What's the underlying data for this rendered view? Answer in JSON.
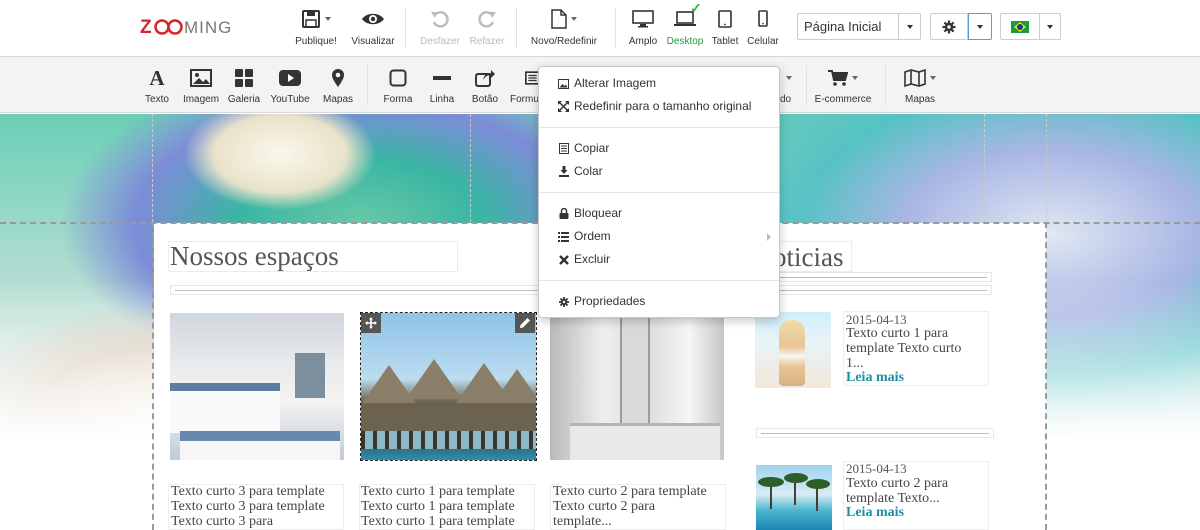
{
  "brand": {
    "logo_text": "ZOOMING"
  },
  "toolbar": {
    "publish": "Publique!",
    "preview": "Visualizar",
    "undo": "Desfazer",
    "redo": "Refazer",
    "new_reset": "Novo/Redefinir",
    "devices": [
      "Amplo",
      "Desktop",
      "Tablet",
      "Celular"
    ],
    "active_device": "Desktop",
    "page_select": "Página Inicial"
  },
  "insert_bar": {
    "items": [
      "Texto",
      "Imagem",
      "Galeria",
      "YouTube",
      "Mapas",
      "Forma",
      "Linha",
      "Botão",
      "Formu",
      "E-commerce",
      "Mapas"
    ],
    "partial_label": "do"
  },
  "context_menu": {
    "items": [
      {
        "label": "Alterar Imagem",
        "icon": "image-icon"
      },
      {
        "label": "Redefinir para o tamanho original",
        "icon": "resize-icon"
      },
      {
        "label": "Copiar",
        "icon": "copy-icon"
      },
      {
        "label": "Colar",
        "icon": "paste-icon"
      },
      {
        "label": "Bloquear",
        "icon": "lock-icon"
      },
      {
        "label": "Ordem",
        "icon": "list-icon"
      },
      {
        "label": "Excluir",
        "icon": "close-icon"
      },
      {
        "label": "Propriedades",
        "icon": "gear-icon"
      }
    ]
  },
  "page": {
    "section_title": "Nossos espaços",
    "news_title": "oticias",
    "captions": [
      [
        "Texto curto 3 para template",
        "Texto curto 3 para template",
        "Texto curto 3 para"
      ],
      [
        "Texto curto 1 para template",
        "Texto curto 1 para template",
        "Texto curto 1 para template"
      ],
      [
        "Texto curto 2 para template",
        "Texto curto 2 para",
        "template..."
      ]
    ],
    "news": [
      {
        "date": "2015-04-13",
        "lines": [
          "Texto curto 1 para",
          "template Texto curto",
          "1..."
        ],
        "more": "Leia mais"
      },
      {
        "date": "2015-04-13",
        "lines": [
          "Texto curto 2 para",
          "template Texto..."
        ],
        "more": "Leia mais"
      }
    ]
  }
}
